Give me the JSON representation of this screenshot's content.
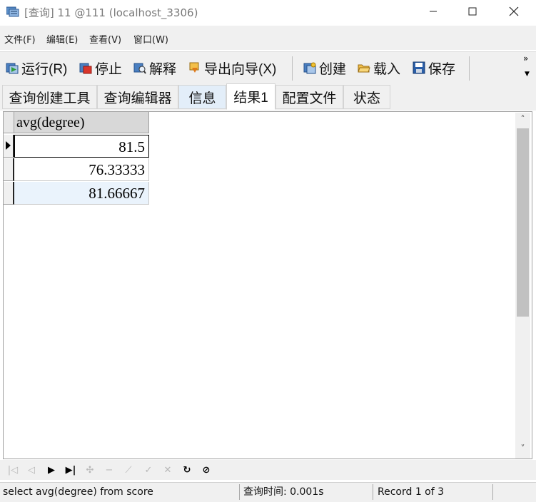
{
  "window": {
    "title": "[查询] 11 @111 (localhost_3306)"
  },
  "menu": [
    "文件(F)",
    "编辑(E)",
    "查看(V)",
    "窗口(W)"
  ],
  "toolbar": {
    "run": "运行(R)",
    "stop": "停止",
    "explain": "解释",
    "export_wizard": "导出向导(X)",
    "create": "创建",
    "load": "载入",
    "save": "保存",
    "more": "»"
  },
  "tabs": [
    "查询创建工具",
    "查询编辑器",
    "信息",
    "结果1",
    "配置文件",
    "状态"
  ],
  "grid": {
    "columns": [
      "avg(degree)"
    ],
    "rows": [
      [
        "81.5"
      ],
      [
        "76.33333"
      ],
      [
        "81.66667"
      ]
    ]
  },
  "statusbar": {
    "sql": "select avg(degree) from score",
    "query_time": "查询时间: 0.001s",
    "record": "Record 1 of 3"
  },
  "colors": {
    "selected_row_bg": "#eaf3fc",
    "tab_active_bg": "#ffffff",
    "chrome_bg": "#f0f0f0"
  }
}
